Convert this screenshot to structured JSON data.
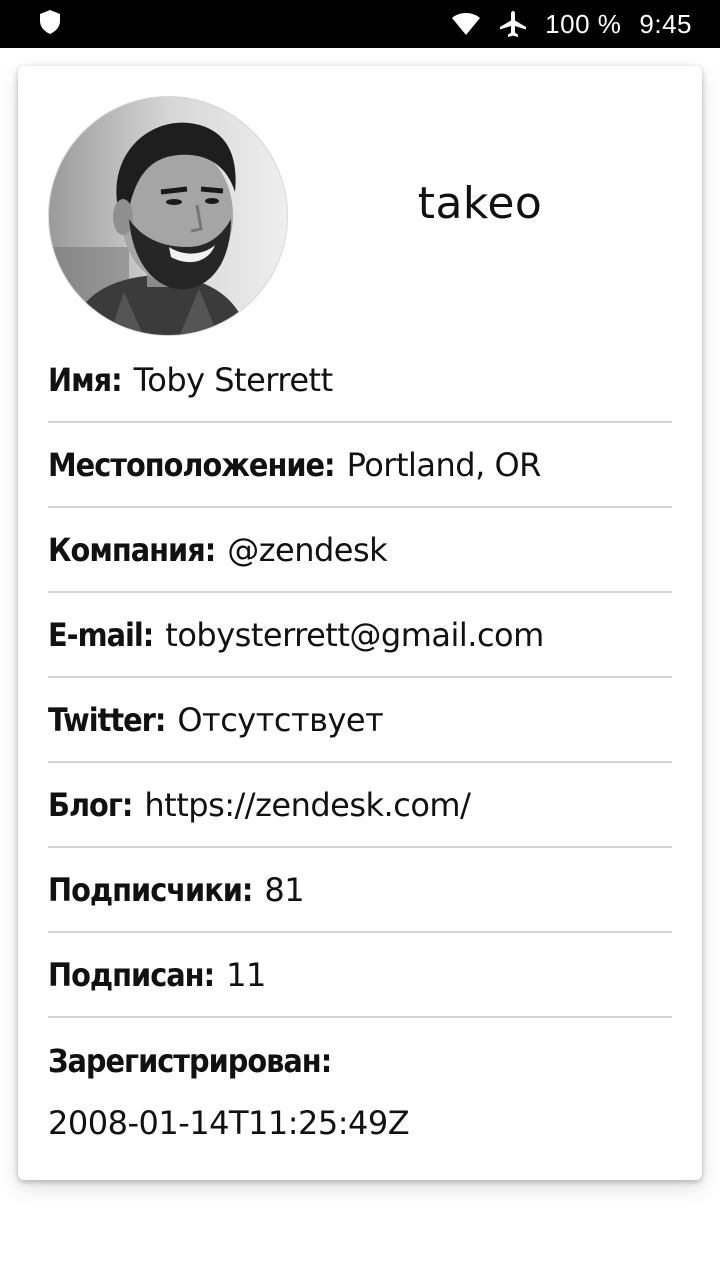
{
  "status_bar": {
    "battery": "100 %",
    "time": "9:45",
    "icons": [
      "shield-icon",
      "wifi-icon",
      "airplane-icon"
    ]
  },
  "profile": {
    "username": "takeo",
    "avatar": "portrait-photo"
  },
  "fields": {
    "name": {
      "label": "Имя:",
      "value": "Toby Sterrett"
    },
    "location": {
      "label": "Местоположение:",
      "value": "Portland, OR"
    },
    "company": {
      "label": "Компания:",
      "value": "@zendesk"
    },
    "email": {
      "label": "E-mail:",
      "value": "tobysterrett@gmail.com"
    },
    "twitter": {
      "label": "Twitter:",
      "value": "Отсутствует"
    },
    "blog": {
      "label": "Блог:",
      "value": "https://zendesk.com/"
    },
    "followers": {
      "label": "Подписчики:",
      "value": "81"
    },
    "following": {
      "label": "Подписан:",
      "value": "11"
    },
    "registered": {
      "label": "Зарегистрирован:",
      "value": "2008-01-14T11:25:49Z"
    }
  }
}
